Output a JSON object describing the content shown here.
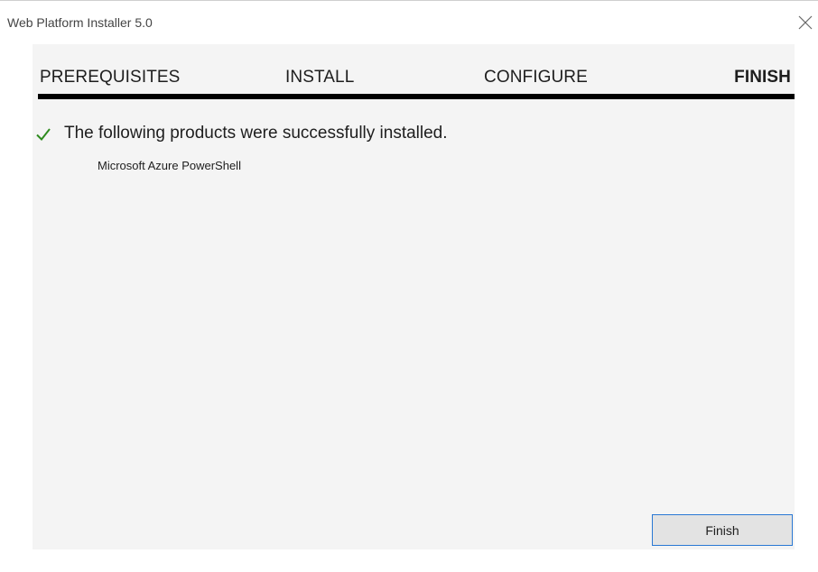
{
  "window": {
    "title": "Web Platform Installer 5.0"
  },
  "steps": [
    {
      "label": "PREREQUISITES",
      "active": false
    },
    {
      "label": "INSTALL",
      "active": false
    },
    {
      "label": "CONFIGURE",
      "active": false
    },
    {
      "label": "FINISH",
      "active": true
    }
  ],
  "result": {
    "message": "The following products were successfully installed.",
    "products": [
      "Microsoft Azure PowerShell"
    ],
    "status_icon": "checkmark-icon",
    "status_color": "#2e8b1e"
  },
  "actions": {
    "finish_label": "Finish",
    "accent_color": "#2a78d4"
  },
  "icons": {
    "close": "close-icon"
  }
}
